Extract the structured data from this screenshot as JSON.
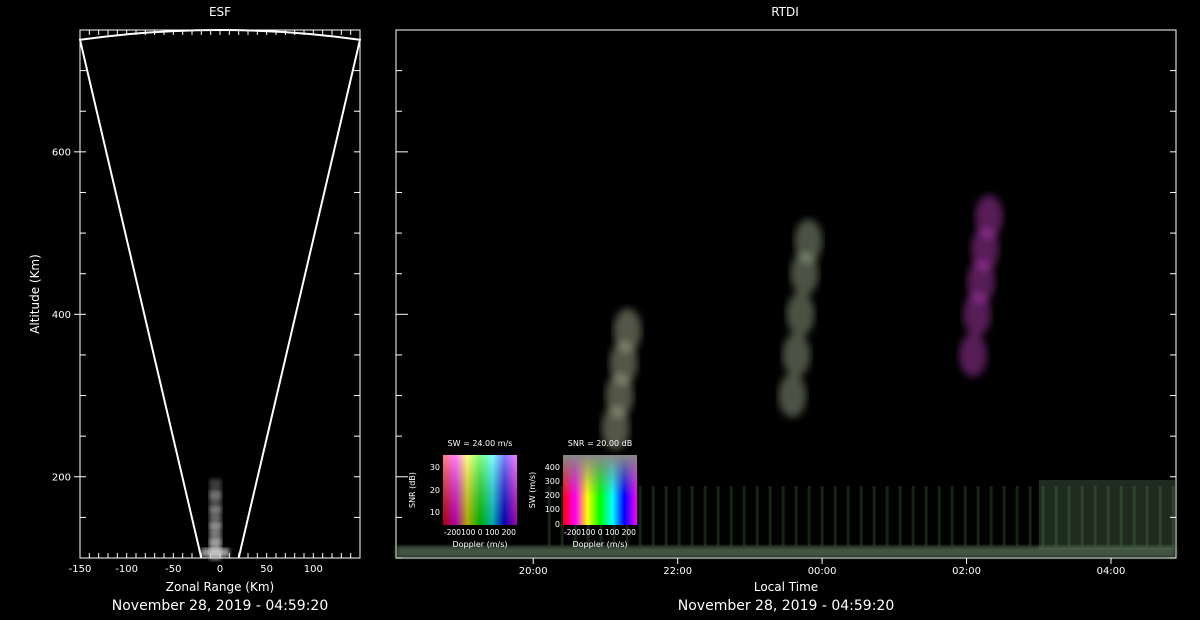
{
  "chart_data": [
    {
      "type": "scatter",
      "title": "ESF",
      "xlabel": "Zonal Range (Km)",
      "ylabel": "Altitude (Km)",
      "xlim": [
        -150,
        150
      ],
      "ylim": [
        100,
        750
      ],
      "xticks": [
        -150,
        -100,
        -50,
        0,
        50,
        100
      ],
      "yticks": [
        200,
        400,
        600
      ],
      "fan_outline": {
        "bottom_x": [
          -20,
          20
        ],
        "top_x": [
          -150,
          150
        ],
        "top_y": 738,
        "arc_peak_y": 750
      },
      "echo": {
        "x": -5,
        "altitudes": [
          110,
          130,
          150,
          170,
          185
        ]
      },
      "timestamp": "November 28, 2019 - 04:59:20"
    },
    {
      "type": "heatmap",
      "title": "RTDI",
      "xlabel": "Local Time",
      "xticks": [
        "20:00",
        "22:00",
        "00:00",
        "02:00",
        "04:00"
      ],
      "ylim": [
        100,
        750
      ],
      "time_hours_range": [
        18.1,
        28.9
      ],
      "plumes": [
        {
          "time_hours": 21.25,
          "altitudes": [
            260,
            300,
            340,
            380
          ],
          "color": "#b8c0a0"
        },
        {
          "time_hours": 23.7,
          "altitudes": [
            300,
            350,
            400,
            450,
            490
          ],
          "color": "#a8b898"
        },
        {
          "time_hours": 26.2,
          "altitudes": [
            350,
            400,
            440,
            480,
            520
          ],
          "color": "#c040c0"
        }
      ],
      "timestamp": "November 28, 2019 - 04:59:20",
      "insets": [
        {
          "title": "SW = 24.00 m/s",
          "ylabel": "SNR (dB)",
          "yticks": [
            "30",
            "20",
            "10"
          ],
          "xlabel": "Doppler (m/s)",
          "xticks": "-200100  0  100 200"
        },
        {
          "title": "SNR = 20.00 dB",
          "ylabel": "SW (m/s)",
          "yticks": [
            "400",
            "300",
            "200",
            "100",
            "0"
          ],
          "xlabel": "Doppler (m/s)",
          "xticks": "-200100  0  100 200"
        }
      ]
    }
  ]
}
